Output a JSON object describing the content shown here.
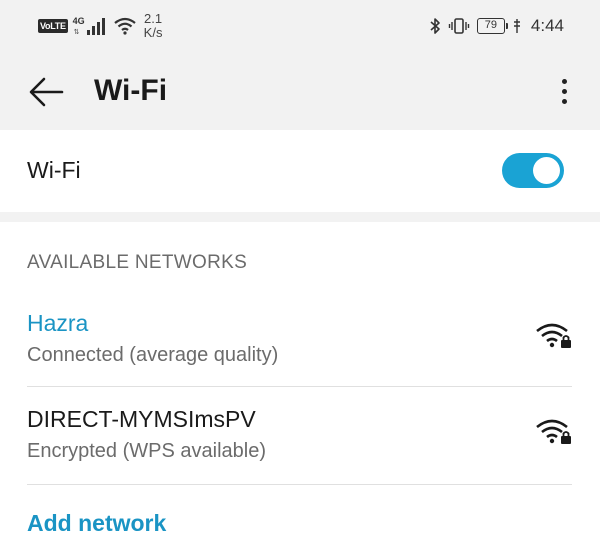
{
  "status_bar": {
    "volte": "VoLTE",
    "network_type": "4G",
    "speed_value": "2.1",
    "speed_unit": "K/s",
    "battery": "79",
    "time": "4:44"
  },
  "app_bar": {
    "title": "Wi-Fi"
  },
  "wifi_toggle": {
    "label": "Wi-Fi",
    "on": true
  },
  "networks": {
    "section_title": "AVAILABLE NETWORKS",
    "items": [
      {
        "name": "Hazra",
        "status": "Connected (average quality)",
        "connected": true
      },
      {
        "name": "DIRECT-MYMSImsPV",
        "status": "Encrypted (WPS available)",
        "connected": false
      }
    ],
    "add_label": "Add network"
  },
  "colors": {
    "accent": "#1aa3d4",
    "connected_text": "#1a94c4",
    "secondary_text": "#6b6b6b"
  }
}
